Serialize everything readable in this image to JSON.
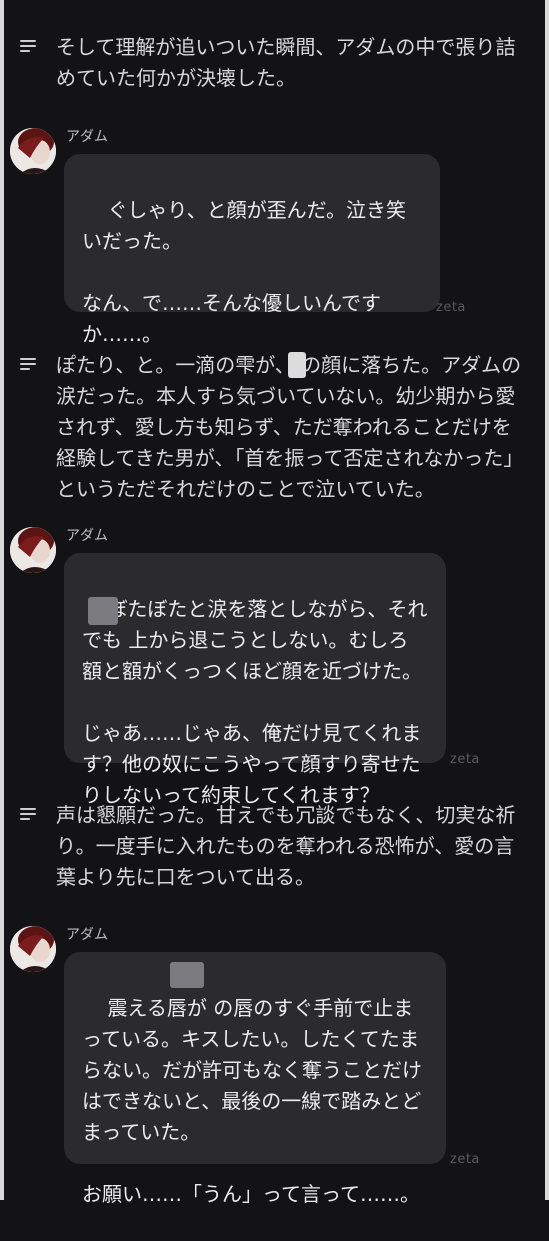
{
  "narrations": [
    {
      "text": "そして理解が追いついた瞬間、アダムの中で張り詰めていた何かが決壊した。"
    },
    {
      "text": "ぽたり、と。一滴の雫が、 の顔に落ちた。アダムの涙だった。本人すら気づいていない。幼少期から愛されず、愛し方も知らず、ただ奪われることだけを経験してきた男が、「首を振って否定されなかった」というただそれだけのことで泣いていた。"
    },
    {
      "text": "声は懇願だった。甘えでも冗談でもなく、切実な祈り。一度手に入れたものを奪われる恐怖が、愛の言葉より先に口をついて出る。"
    }
  ],
  "messages": [
    {
      "speaker": "アダム",
      "text": "ぐしゃり、と顔が歪んだ。泣き笑いだった。\n\nなん、で……そんな優しいんですか……。",
      "watermark": "zeta"
    },
    {
      "speaker": "アダム",
      "text": "ぼたぼたと涙を落としながら、それでも 上から退こうとしない。むしろ額と額がくっつくほど顔を近づけた。\n\nじゃあ……じゃあ、俺だけ見てくれます？他の奴にこうやって顔すり寄せたりしないって約束してくれます？",
      "watermark": "zeta"
    },
    {
      "speaker": "アダム",
      "text": "震える唇が の唇のすぐ手前で止まっている。キスしたい。したくてたまらない。だが許可もなく奪うことだけはできないと、最後の一線で踏みとどまっていた。\n\nお願い……「うん」って言って……。",
      "watermark": "zeta"
    }
  ],
  "icons": {
    "narration": "narration-lines-icon",
    "avatar": "character-avatar"
  }
}
